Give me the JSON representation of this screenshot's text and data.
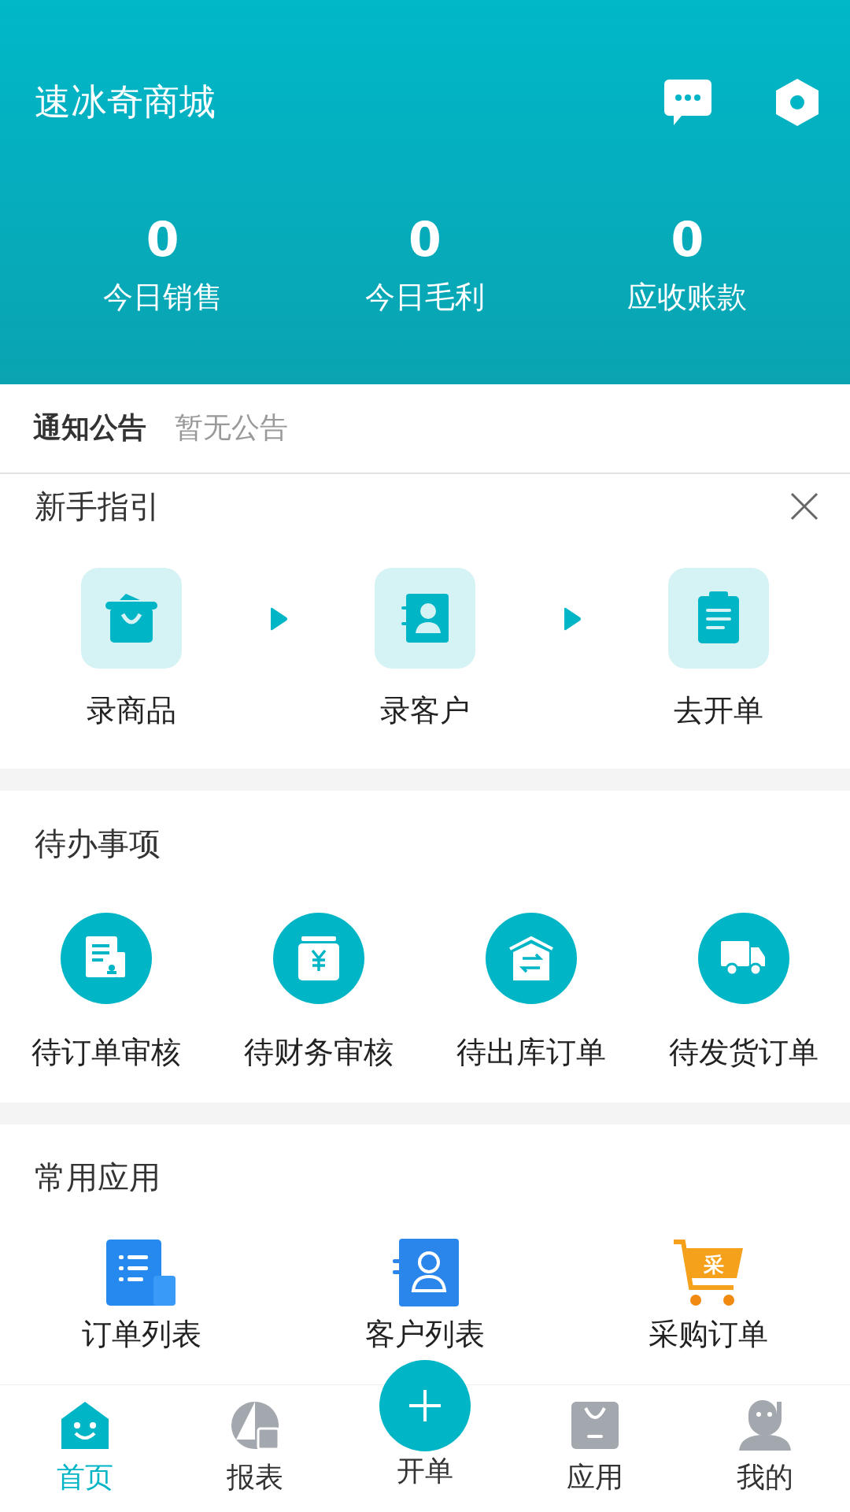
{
  "header": {
    "title": "速冰奇商城"
  },
  "stats": [
    {
      "value": "0",
      "label": "今日销售"
    },
    {
      "value": "0",
      "label": "今日毛利"
    },
    {
      "value": "0",
      "label": "应收账款"
    }
  ],
  "notice": {
    "label": "通知公告",
    "text": "暂无公告"
  },
  "guide": {
    "title": "新手指引",
    "steps": [
      {
        "kind": "goods",
        "label": "录商品"
      },
      {
        "kind": "contacts",
        "label": "录客户"
      },
      {
        "kind": "clipboard",
        "label": "去开单"
      }
    ]
  },
  "todo": {
    "title": "待办事项",
    "items": [
      {
        "kind": "document",
        "label": "待订单审核"
      },
      {
        "kind": "money",
        "label": "待财务审核"
      },
      {
        "kind": "warehouse",
        "label": "待出库订单"
      },
      {
        "kind": "truck",
        "label": "待发货订单"
      }
    ]
  },
  "apps": {
    "title": "常用应用",
    "items": [
      {
        "kind": "list",
        "label": "订单列表"
      },
      {
        "kind": "contacts",
        "label": "客户列表"
      },
      {
        "kind": "cart",
        "label": "采购订单",
        "badge": "采"
      }
    ]
  },
  "nav": [
    {
      "kind": "home",
      "label": "首页",
      "selected": true
    },
    {
      "kind": "report",
      "label": "报表",
      "selected": false
    },
    {
      "kind": "create",
      "label": "开单",
      "selected": false
    },
    {
      "kind": "apps",
      "label": "应用",
      "selected": false
    },
    {
      "kind": "profile",
      "label": "我的",
      "selected": false
    }
  ]
}
